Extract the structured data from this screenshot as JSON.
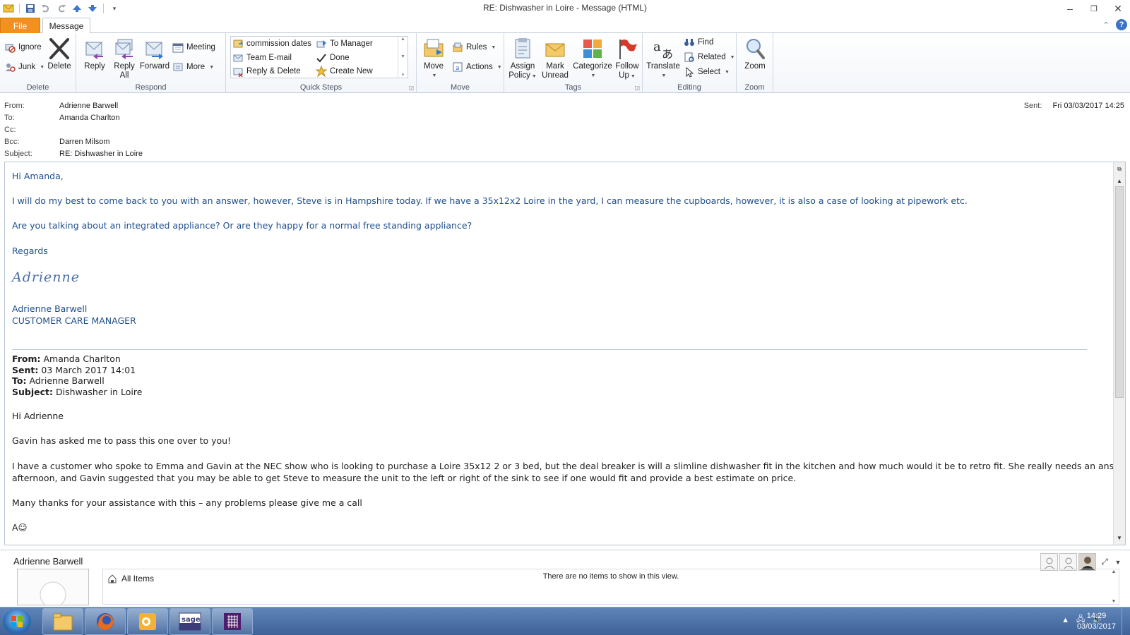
{
  "window": {
    "title": "RE: Dishwasher in Loire  -  Message (HTML)"
  },
  "tabs": {
    "file": "File",
    "message": "Message"
  },
  "ribbon": {
    "delete_group": {
      "label": "Delete",
      "ignore": "Ignore",
      "junk": "Junk",
      "delete": "Delete"
    },
    "respond_group": {
      "label": "Respond",
      "reply": "Reply",
      "reply_all_1": "Reply",
      "reply_all_2": "All",
      "forward": "Forward",
      "meeting": "Meeting",
      "more": "More"
    },
    "quicksteps_group": {
      "label": "Quick Steps",
      "items": [
        "commission dates",
        "To Manager",
        "Team E-mail",
        "Done",
        "Reply & Delete",
        "Create New"
      ]
    },
    "move_group": {
      "label": "Move",
      "move": "Move",
      "rules": "Rules",
      "actions": "Actions"
    },
    "tags_group": {
      "label": "Tags",
      "assign_1": "Assign",
      "assign_2": "Policy",
      "mark_1": "Mark",
      "mark_2": "Unread",
      "categorize": "Categorize",
      "follow_1": "Follow",
      "follow_2": "Up"
    },
    "editing_group": {
      "label": "Editing",
      "translate": "Translate",
      "find": "Find",
      "related": "Related",
      "select": "Select"
    },
    "zoom_group": {
      "label": "Zoom",
      "zoom": "Zoom"
    }
  },
  "header": {
    "from_label": "From:",
    "from": "Adrienne Barwell",
    "to_label": "To:",
    "to": "Amanda Charlton",
    "cc_label": "Cc:",
    "cc": "",
    "bcc_label": "Bcc:",
    "bcc": "Darren Milsom",
    "subject_label": "Subject:",
    "subject": "RE: Dishwasher in Loire",
    "sent_label": "Sent:",
    "sent": "Fri 03/03/2017 14:25"
  },
  "body": {
    "greeting": "Hi Amanda,",
    "p1": "I will do my best to come back to you with an answer, however,  Steve is in Hampshire today.  If we have a 35x12x2 Loire in the yard, I can measure the cupboards, however, it is also a case of looking at pipework etc.",
    "p2": "Are you talking about an integrated appliance?  Or are they happy for a normal free standing appliance?",
    "regards": "Regards",
    "signature_script": "Adrienne",
    "sig_name": "Adrienne Barwell",
    "sig_title": "CUSTOMER CARE MANAGER",
    "quoted": {
      "from_label": "From:",
      "from": "Amanda Charlton",
      "sent_label": "Sent:",
      "sent": "03 March 2017 14:01",
      "to_label": "To:",
      "to": "Adrienne Barwell",
      "subject_label": "Subject:",
      "subject": "Dishwasher in Loire",
      "greeting": "Hi Adrienne",
      "p1": "Gavin has asked me to pass this one over to you!",
      "p2a": "I have a customer who spoke to Emma and Gavin at the NEC show who is looking to purchase a Loire 35x12 2 or 3 bed, but the deal breaker is will a slimline dishwasher fit in the kitchen and how much would it be to retro fit.  She really needs an answer this",
      "p2b": "afternoon, and Gavin suggested that you may be able to get Steve to measure the unit to the left or right of the sink to see if one would fit and provide a best estimate on price.",
      "p3": "Many thanks for your assistance with this – any problems please give me a call",
      "closing": "A☺"
    }
  },
  "people_pane": {
    "name": "Adrienne Barwell",
    "all_items": "All Items",
    "no_items": "There are no items to show in this view."
  },
  "taskbar": {
    "time": "14:29",
    "date": "03/03/2017"
  },
  "colors": {
    "file_tab": "#f2911b",
    "body_text_blue": "#1f4e8c",
    "taskbar": "#4a6fa6"
  }
}
